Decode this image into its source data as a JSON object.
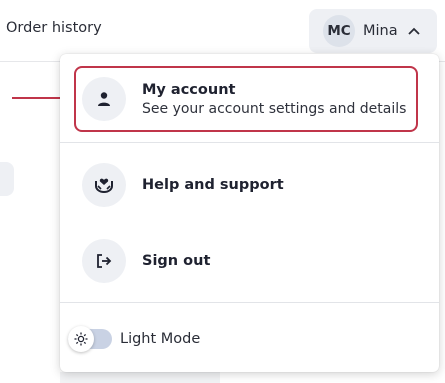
{
  "header": {
    "order_history": "Order history",
    "user": {
      "initials": "MC",
      "name": "Mina"
    }
  },
  "menu": {
    "items": [
      {
        "title": "My account",
        "subtitle": "See your account settings and details",
        "icon": "person-icon"
      },
      {
        "title": "Help and support",
        "icon": "support-hands-icon"
      },
      {
        "title": "Sign out",
        "icon": "sign-out-icon"
      }
    ],
    "theme_toggle": {
      "label": "Light Mode",
      "icon": "sun-icon"
    }
  },
  "colors": {
    "highlight": "#c0354a",
    "icon_bg": "#eef0f4",
    "toggle_track": "#c9d2e4"
  }
}
